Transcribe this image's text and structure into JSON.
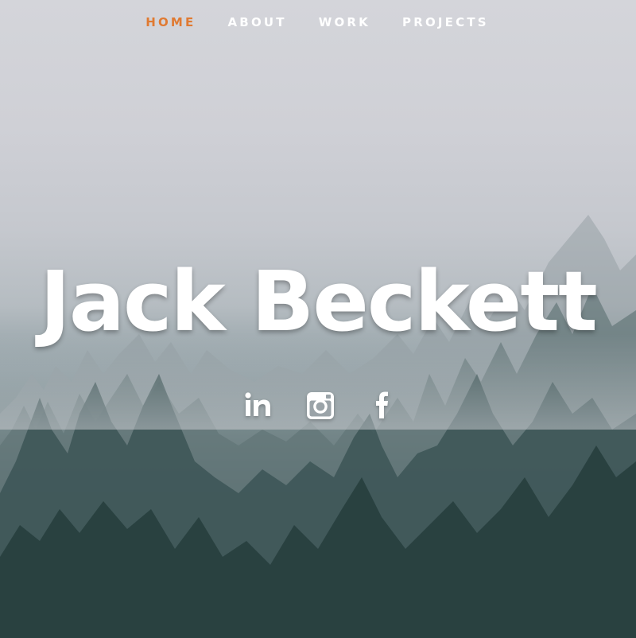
{
  "nav": {
    "items": [
      {
        "label": "HOME",
        "active": true
      },
      {
        "label": "ABOUT",
        "active": false
      },
      {
        "label": "WORK",
        "active": false
      },
      {
        "label": "PROJECTS",
        "active": false
      }
    ],
    "active_color": "#e07a32"
  },
  "hero": {
    "title": "Jack Beckett"
  },
  "socials": [
    {
      "icon": "linkedin-icon"
    },
    {
      "icon": "instagram-icon"
    },
    {
      "icon": "facebook-icon"
    }
  ]
}
